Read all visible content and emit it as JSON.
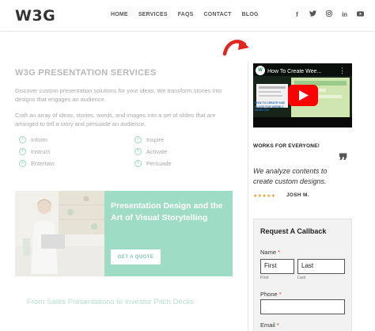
{
  "header": {
    "logo": "W3G",
    "nav": [
      "HOME",
      "SERVICES",
      "FAQS",
      "CONTACT",
      "BLOG"
    ],
    "social": [
      {
        "icon": "facebook-icon",
        "glyph": "f"
      },
      {
        "icon": "twitter-icon",
        "glyph": "t"
      },
      {
        "icon": "instagram-icon",
        "glyph": "◎"
      },
      {
        "icon": "linkedin-icon",
        "glyph": "in"
      },
      {
        "icon": "youtube-icon",
        "glyph": "▶"
      }
    ]
  },
  "main": {
    "title": "W3G PRESENTATION SERVICES",
    "para1": "Discover custom presentation solutions for your ideas. We transform stories into designs that engages an audience.",
    "para2": "Craft an array of ideas, stories, words, and images into a set of slides that are arranged to tell a story and persuade an audience.",
    "features": [
      "Inform",
      "Inspire",
      "Instruct",
      "Activate",
      "Entertain",
      "Persuade"
    ],
    "banner": {
      "title": "Presentation Design and the Art of Visual Storytelling",
      "button": "GET A QUOTE"
    },
    "tagline": "From Sales Presentations to Investor Pitch Decks"
  },
  "sidebar": {
    "video": {
      "title": "How To Create Wee...",
      "caption": "HOW TO CREATE SUB BLOGS FOR WEEBLY WEBSITES"
    },
    "works_heading": "WORKS FOR EVERYONE!",
    "quote_mark": "❞",
    "testimonial": "We analyze contents to create custom designs.",
    "stars": "★★★★★",
    "rating": 5,
    "author": "JOSH M.",
    "form": {
      "title": "Request A Callback",
      "name_label": "Name",
      "required_mark": "*",
      "first_value": "First",
      "last_value": "Last",
      "first_sub": "First",
      "last_sub": "Last",
      "phone_label": "Phone",
      "email_label": "Email"
    }
  },
  "colors": {
    "accent_green": "#9fdcc6",
    "arrow_red": "#e0261f",
    "star_orange": "#e39f2b",
    "youtube_red": "#ff0000"
  }
}
